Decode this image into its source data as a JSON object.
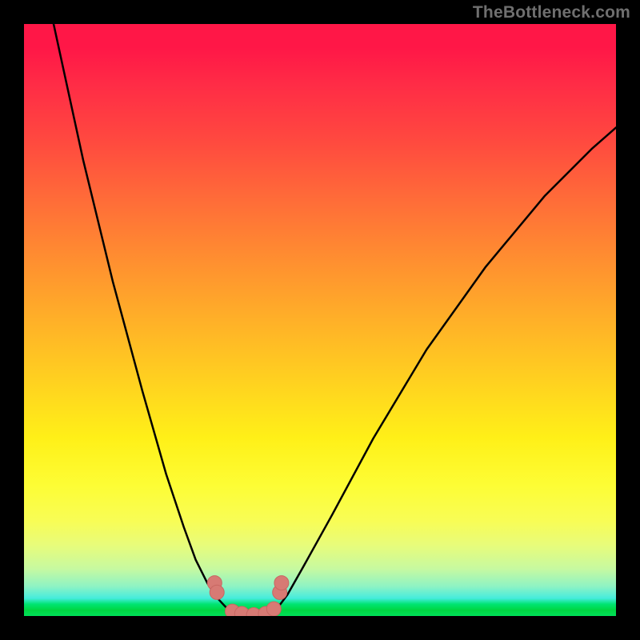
{
  "attribution": "TheBottleneck.com",
  "colors": {
    "frame": "#000000",
    "curve_stroke": "#000000",
    "marker_fill": "#d77a74",
    "marker_stroke": "#c86762"
  },
  "chart_data": {
    "type": "line",
    "title": "",
    "xlabel": "",
    "ylabel": "",
    "xlim": [
      0,
      1
    ],
    "ylim": [
      0,
      1
    ],
    "series": [
      {
        "name": "left-branch",
        "x": [
          0.05,
          0.1,
          0.15,
          0.2,
          0.24,
          0.27,
          0.29,
          0.31,
          0.325,
          0.34,
          0.352
        ],
        "y": [
          1.0,
          0.77,
          0.565,
          0.38,
          0.24,
          0.15,
          0.095,
          0.055,
          0.032,
          0.016,
          0.006
        ]
      },
      {
        "name": "right-branch",
        "x": [
          0.42,
          0.43,
          0.445,
          0.47,
          0.52,
          0.59,
          0.68,
          0.78,
          0.88,
          0.96,
          1.0
        ],
        "y": [
          0.006,
          0.016,
          0.036,
          0.08,
          0.17,
          0.3,
          0.45,
          0.59,
          0.71,
          0.79,
          0.825
        ]
      },
      {
        "name": "trough",
        "x": [
          0.352,
          0.36,
          0.372,
          0.388,
          0.402,
          0.414,
          0.42
        ],
        "y": [
          0.006,
          0.002,
          0.0,
          0.0,
          0.001,
          0.003,
          0.006
        ]
      }
    ],
    "markers": {
      "name": "trough-points",
      "x": [
        0.322,
        0.326,
        0.352,
        0.368,
        0.388,
        0.408,
        0.422,
        0.432,
        0.435
      ],
      "y": [
        0.056,
        0.04,
        0.008,
        0.004,
        0.002,
        0.004,
        0.012,
        0.04,
        0.056
      ]
    }
  }
}
